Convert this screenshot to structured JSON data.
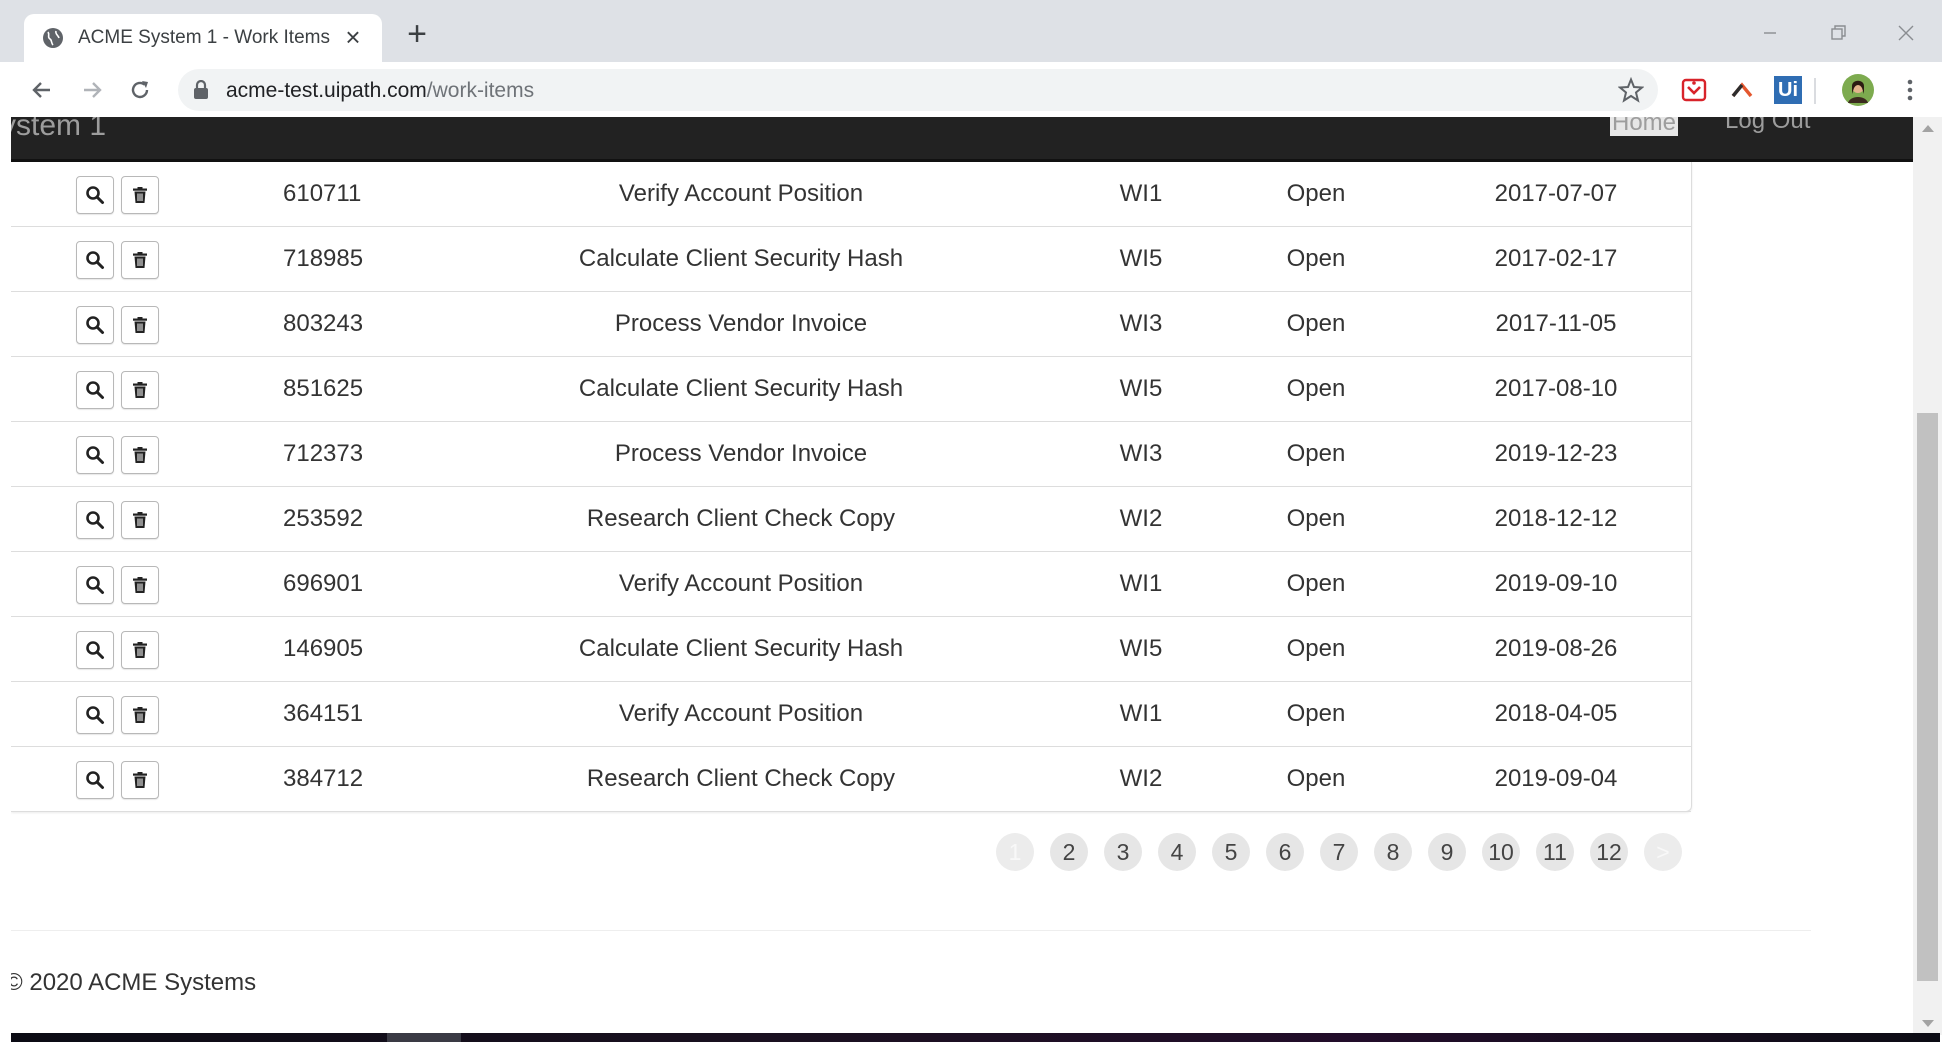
{
  "browser": {
    "tab_title": "ACME System 1 - Work Items",
    "url_host": "acme-test.uipath.com",
    "url_path": "/work-items"
  },
  "navbar": {
    "brand": "ystem 1",
    "home": "Home",
    "logout": "Log Out"
  },
  "work_items": [
    {
      "id": "610711",
      "description": "Verify Account Position",
      "type": "WI1",
      "status": "Open",
      "date": "2017-07-07"
    },
    {
      "id": "718985",
      "description": "Calculate Client Security Hash",
      "type": "WI5",
      "status": "Open",
      "date": "2017-02-17"
    },
    {
      "id": "803243",
      "description": "Process Vendor Invoice",
      "type": "WI3",
      "status": "Open",
      "date": "2017-11-05"
    },
    {
      "id": "851625",
      "description": "Calculate Client Security Hash",
      "type": "WI5",
      "status": "Open",
      "date": "2017-08-10"
    },
    {
      "id": "712373",
      "description": "Process Vendor Invoice",
      "type": "WI3",
      "status": "Open",
      "date": "2019-12-23"
    },
    {
      "id": "253592",
      "description": "Research Client Check Copy",
      "type": "WI2",
      "status": "Open",
      "date": "2018-12-12"
    },
    {
      "id": "696901",
      "description": "Verify Account Position",
      "type": "WI1",
      "status": "Open",
      "date": "2019-09-10"
    },
    {
      "id": "146905",
      "description": "Calculate Client Security Hash",
      "type": "WI5",
      "status": "Open",
      "date": "2019-08-26"
    },
    {
      "id": "364151",
      "description": "Verify Account Position",
      "type": "WI1",
      "status": "Open",
      "date": "2018-04-05"
    },
    {
      "id": "384712",
      "description": "Research Client Check Copy",
      "type": "WI2",
      "status": "Open",
      "date": "2019-09-04"
    }
  ],
  "pagination": {
    "pages": [
      "1",
      "2",
      "3",
      "4",
      "5",
      "6",
      "7",
      "8",
      "9",
      "10",
      "11",
      "12",
      ">"
    ],
    "current": "1"
  },
  "footer": {
    "text": "© 2020 ACME Systems"
  },
  "colors": {
    "navbar_bg": "#222222",
    "nav_text": "#9d9d9d",
    "pager_bg": "#e6e6e6"
  }
}
